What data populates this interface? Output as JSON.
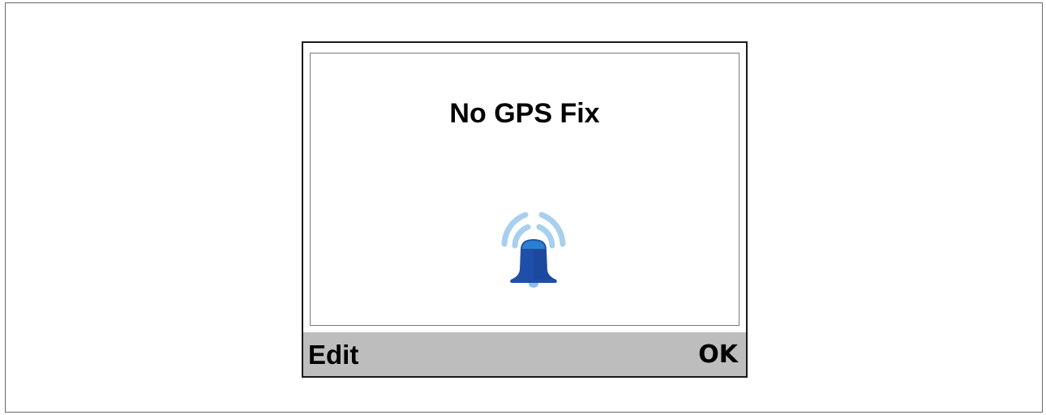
{
  "alert": {
    "title": "No GPS Fix",
    "icon": "alarm-bell-icon"
  },
  "softkeys": {
    "left_label": "Edit",
    "right_label": "OK"
  },
  "colors": {
    "bell_body": "#1f4fa8",
    "bell_top": "#2a7fd0",
    "bell_clapper": "#8ebfe6",
    "signal_waves": "#a9cfee",
    "softkey_bar": "#bdbdbd"
  }
}
